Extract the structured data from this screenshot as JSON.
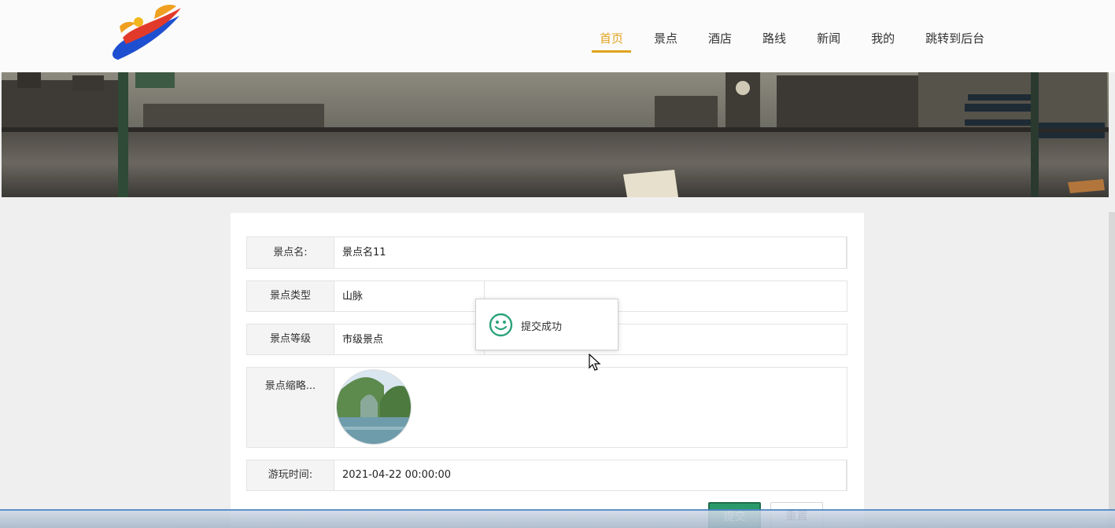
{
  "nav": {
    "items": [
      {
        "label": "首页",
        "active": true
      },
      {
        "label": "景点",
        "active": false
      },
      {
        "label": "酒店",
        "active": false
      },
      {
        "label": "路线",
        "active": false
      },
      {
        "label": "新闻",
        "active": false
      },
      {
        "label": "我的",
        "active": false
      },
      {
        "label": "跳转到后台",
        "active": false
      }
    ],
    "active_color": "#e0a31f"
  },
  "form": {
    "fields": [
      {
        "label": "景点名:",
        "value": "景点名11"
      },
      {
        "label": "景点类型",
        "value": "山脉"
      },
      {
        "label": "景点等级",
        "value": "市级景点"
      },
      {
        "label": "景点缩略...",
        "value": ""
      },
      {
        "label": "游玩时间:",
        "value": "2021-04-22 00:00:00"
      }
    ],
    "submit_label": "提交",
    "reset_label": "重置",
    "submit_color": "#2b9a6a"
  },
  "toast": {
    "message": "提交成功",
    "icon": "smile-icon",
    "icon_color": "#2aa27a"
  },
  "icons": {
    "logo": "logo-icon",
    "cursor": "cursor-icon"
  }
}
